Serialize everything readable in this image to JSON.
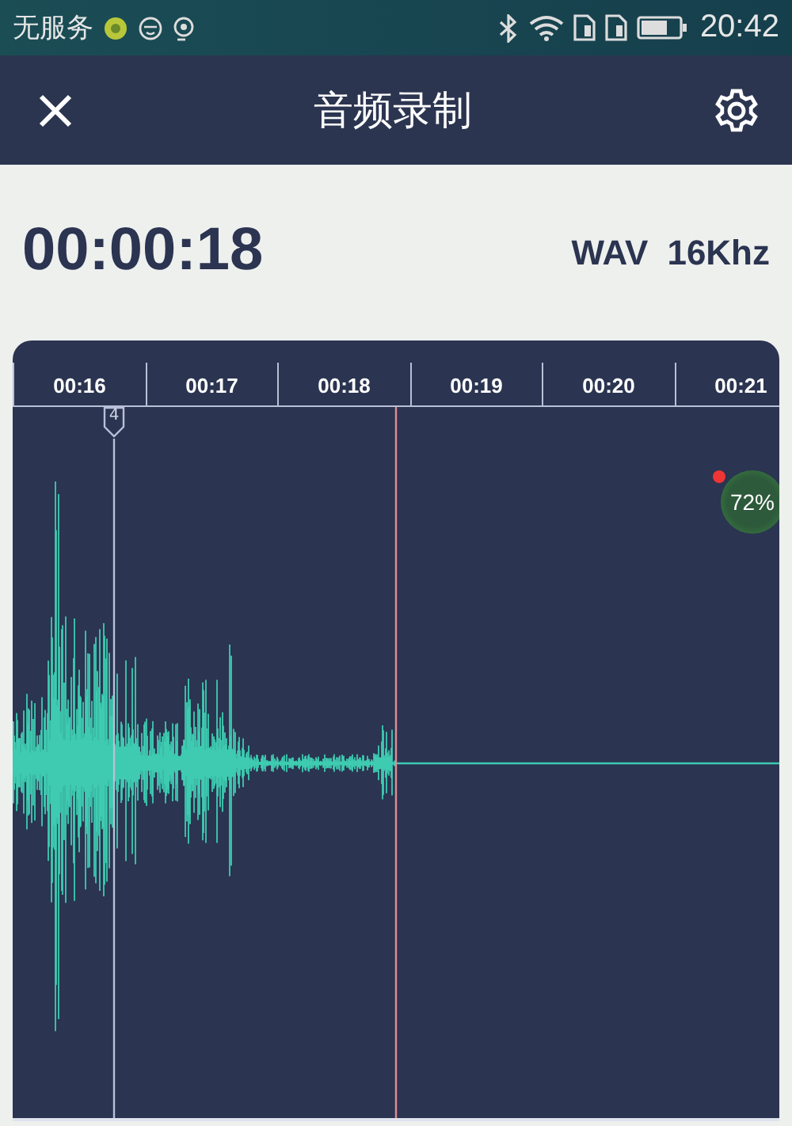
{
  "status_bar": {
    "carrier": "无服务",
    "time": "20:42"
  },
  "header": {
    "title": "音频录制"
  },
  "recording": {
    "elapsed": "00:00:18",
    "format": "WAV",
    "sample_rate": "16Khz"
  },
  "timeline": {
    "ticks": [
      "00:16",
      "00:17",
      "00:18",
      "00:19",
      "00:20",
      "00:21"
    ],
    "marker": "4"
  },
  "badge": {
    "text": "72%"
  }
}
